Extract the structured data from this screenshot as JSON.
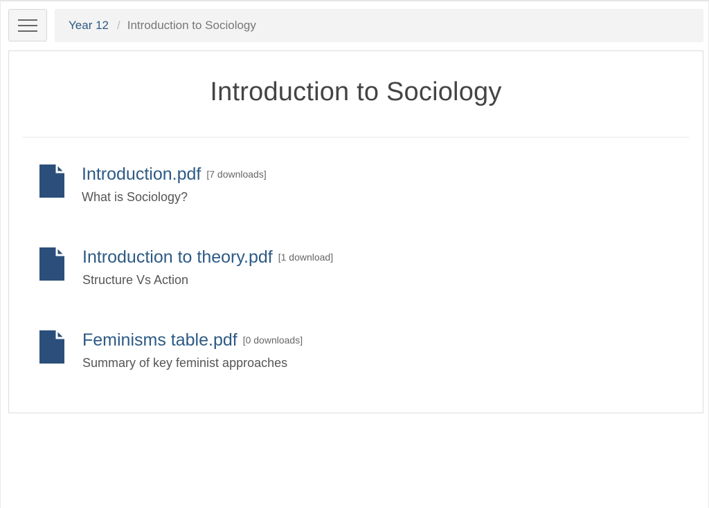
{
  "header": {
    "menu_icon": "hamburger-menu-icon"
  },
  "breadcrumb": {
    "items": [
      {
        "label": "Year 12"
      },
      {
        "label": "Introduction to Sociology"
      }
    ],
    "separator": "/"
  },
  "page": {
    "title": "Introduction to Sociology"
  },
  "files": [
    {
      "name": "Introduction.pdf",
      "downloads": "[7 downloads]",
      "description": "What is Sociology?",
      "icon": "file-icon"
    },
    {
      "name": "Introduction to theory.pdf",
      "downloads": "[1 download]",
      "description": "Structure Vs Action",
      "icon": "file-icon"
    },
    {
      "name": "Feminisms table.pdf",
      "downloads": "[0 downloads]",
      "description": "Summary of key feminist approaches",
      "icon": "file-icon"
    }
  ],
  "colors": {
    "link": "#2d5a85",
    "icon": "#2b4f7a"
  }
}
